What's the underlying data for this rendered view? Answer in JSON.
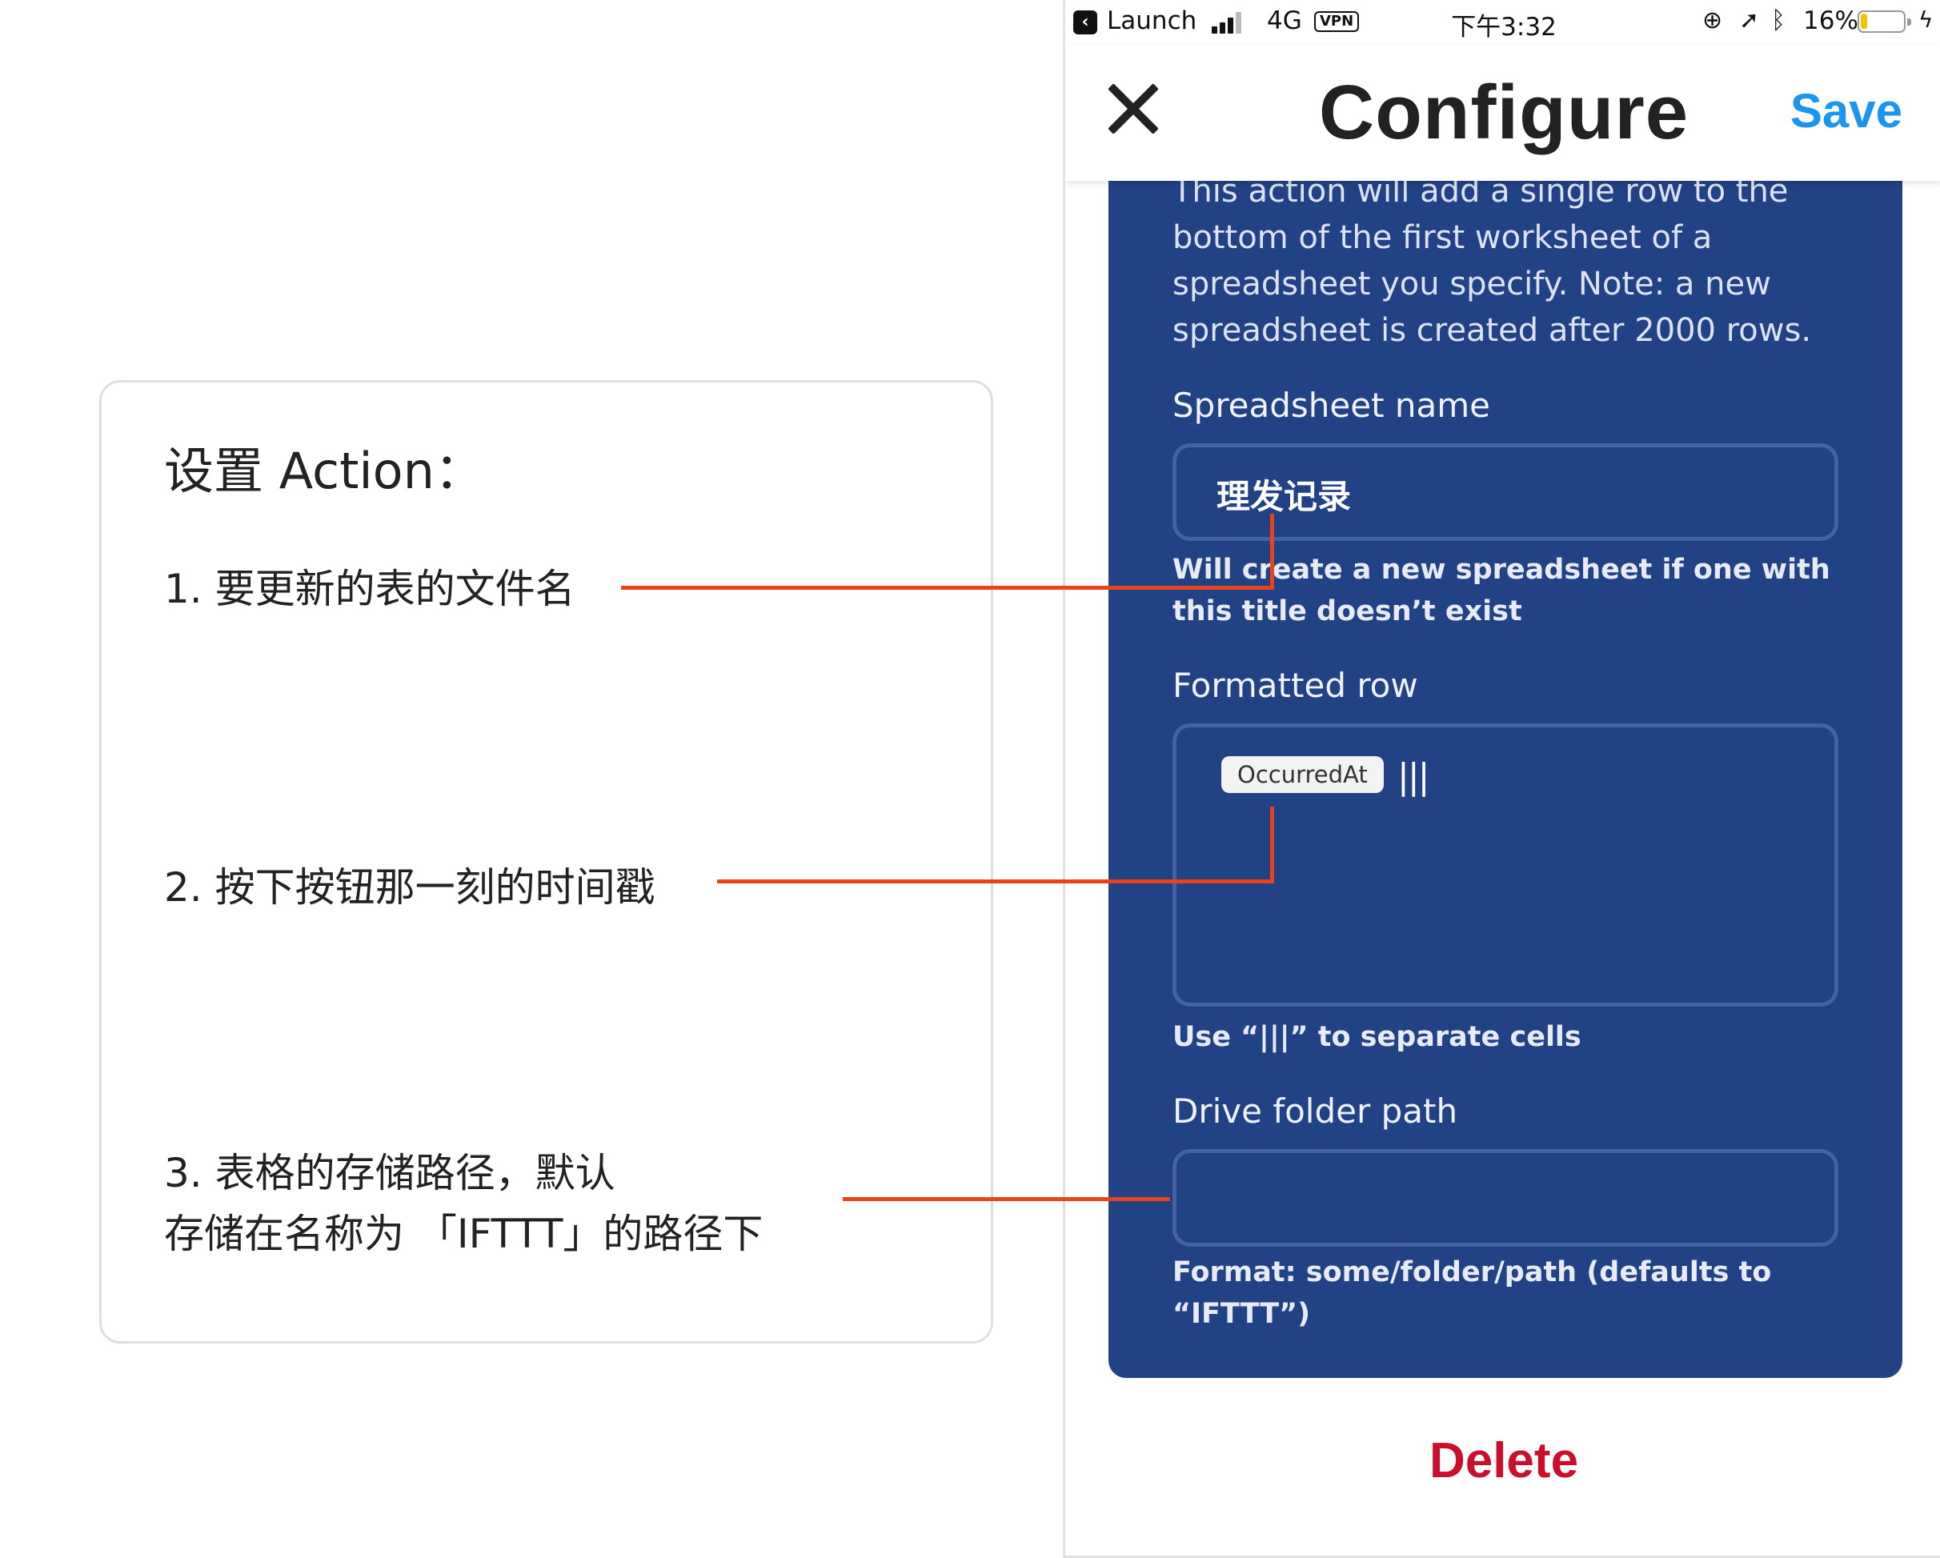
{
  "annotation": {
    "title": "设置 Action：",
    "items": [
      {
        "lines": [
          "1. 要更新的表的文件名"
        ]
      },
      {
        "lines": [
          "2. 按下按钮那一刻的时间戳"
        ]
      },
      {
        "lines": [
          "3. 表格的存储路径，默认",
          "存储在名称为 「IFTTT」的路径下"
        ]
      }
    ],
    "leader_color": "#e8431f"
  },
  "status_bar": {
    "back_app": "Launch",
    "network": "4G",
    "vpn": "VPN",
    "time": "下午3:32",
    "battery": "16%",
    "battery_level": 0.16
  },
  "nav": {
    "title": "Configure",
    "save": "Save",
    "close_icon": "close-icon"
  },
  "action": {
    "description": "This action will add a single row to the bottom of the first worksheet of a spreadsheet you specify. Note: a new spreadsheet is created after 2000 rows.",
    "spreadsheet_name": {
      "label": "Spreadsheet name",
      "value": "理发记录",
      "help": "Will create a new spreadsheet if one with this title doesn’t exist"
    },
    "formatted_row": {
      "label": "Formatted row",
      "ingredient": "OccurredAt",
      "separator": "|||",
      "help": "Use “|||” to separate cells"
    },
    "drive_folder_path": {
      "label": "Drive folder path",
      "value": "",
      "help": "Format: some/folder/path (defaults to “IFTTT”)"
    }
  },
  "delete": "Delete",
  "colors": {
    "card": "#224286",
    "save": "#1a96f0",
    "delete": "#c8102e",
    "leader": "#e8431f"
  }
}
